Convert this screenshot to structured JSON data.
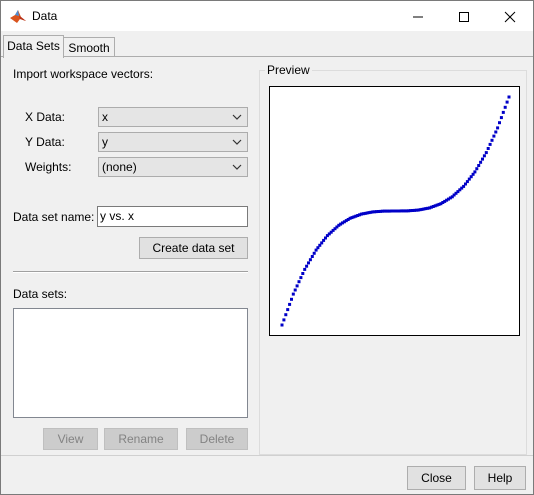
{
  "window": {
    "title": "Data",
    "controls": [
      "minimize-icon",
      "maximize-icon",
      "close-icon"
    ]
  },
  "tabs": [
    {
      "label": "Data Sets",
      "active": true
    },
    {
      "label": "Smooth",
      "active": false
    }
  ],
  "import_section": {
    "heading": "Import workspace vectors:",
    "x_label": "X Data:",
    "x_value": "x",
    "y_label": "Y Data:",
    "y_value": "y",
    "weights_label": "Weights:",
    "weights_value": "(none)"
  },
  "dataset_name": {
    "label": "Data set name:",
    "value": "y vs. x"
  },
  "create_button": "Create data set",
  "datasets": {
    "label": "Data sets:",
    "items": []
  },
  "list_buttons": {
    "view": "View",
    "rename": "Rename",
    "delete": "Delete"
  },
  "preview": {
    "label": "Preview"
  },
  "footer": {
    "close": "Close",
    "help": "Help"
  },
  "colors": {
    "marker": "#0000c8",
    "window_bg": "#f0f0f0",
    "matlab_icon": "#d9541e"
  },
  "chart_data": {
    "type": "scatter",
    "title": "",
    "xlabel": "",
    "ylabel": "",
    "grid": false,
    "marker": "dot",
    "series": [
      {
        "function": "cubic (x-like vs y-like)",
        "x": [
          -1.0,
          -0.9,
          -0.8,
          -0.7,
          -0.6,
          -0.5,
          -0.4,
          -0.3,
          -0.2,
          -0.1,
          0.0,
          0.1,
          0.2,
          0.3,
          0.4,
          0.5,
          0.6,
          0.7,
          0.8,
          0.9,
          1.0
        ],
        "y": [
          -1.0,
          -0.729,
          -0.512,
          -0.343,
          -0.216,
          -0.125,
          -0.064,
          -0.027,
          -0.008,
          -0.001,
          0.0,
          0.001,
          0.008,
          0.027,
          0.064,
          0.125,
          0.216,
          0.343,
          0.512,
          0.729,
          1.0
        ]
      }
    ],
    "xlim": [
      -1,
      1
    ],
    "ylim": [
      -1,
      1
    ]
  }
}
